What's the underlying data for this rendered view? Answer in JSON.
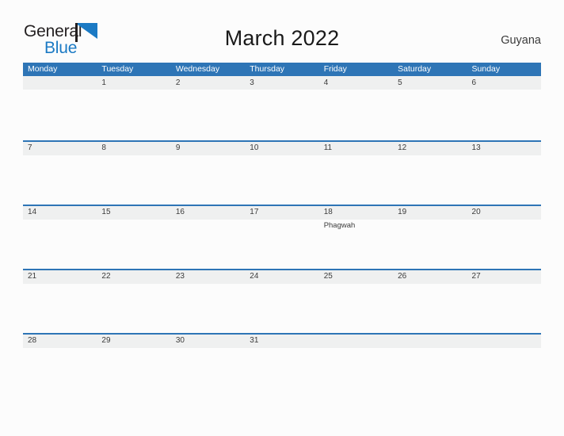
{
  "branding": {
    "logo_text_primary": "General",
    "logo_text_secondary": "Blue",
    "logo_icon": "blue-flag-triangle",
    "accent_color": "#2e75b6",
    "logo_blue": "#1b7ac4"
  },
  "header": {
    "title": "March 2022",
    "region": "Guyana"
  },
  "calendar": {
    "month": "March",
    "year": "2022",
    "weekday_headers": [
      "Monday",
      "Tuesday",
      "Wednesday",
      "Thursday",
      "Friday",
      "Saturday",
      "Sunday"
    ],
    "weeks": [
      {
        "bordered": false,
        "days": [
          {
            "date": "",
            "event": ""
          },
          {
            "date": "1",
            "event": ""
          },
          {
            "date": "2",
            "event": ""
          },
          {
            "date": "3",
            "event": ""
          },
          {
            "date": "4",
            "event": ""
          },
          {
            "date": "5",
            "event": ""
          },
          {
            "date": "6",
            "event": ""
          }
        ]
      },
      {
        "bordered": true,
        "days": [
          {
            "date": "7",
            "event": ""
          },
          {
            "date": "8",
            "event": ""
          },
          {
            "date": "9",
            "event": ""
          },
          {
            "date": "10",
            "event": ""
          },
          {
            "date": "11",
            "event": ""
          },
          {
            "date": "12",
            "event": ""
          },
          {
            "date": "13",
            "event": ""
          }
        ]
      },
      {
        "bordered": true,
        "days": [
          {
            "date": "14",
            "event": ""
          },
          {
            "date": "15",
            "event": ""
          },
          {
            "date": "16",
            "event": ""
          },
          {
            "date": "17",
            "event": ""
          },
          {
            "date": "18",
            "event": "Phagwah"
          },
          {
            "date": "19",
            "event": ""
          },
          {
            "date": "20",
            "event": ""
          }
        ]
      },
      {
        "bordered": true,
        "days": [
          {
            "date": "21",
            "event": ""
          },
          {
            "date": "22",
            "event": ""
          },
          {
            "date": "23",
            "event": ""
          },
          {
            "date": "24",
            "event": ""
          },
          {
            "date": "25",
            "event": ""
          },
          {
            "date": "26",
            "event": ""
          },
          {
            "date": "27",
            "event": ""
          }
        ]
      },
      {
        "bordered": true,
        "days": [
          {
            "date": "28",
            "event": ""
          },
          {
            "date": "29",
            "event": ""
          },
          {
            "date": "30",
            "event": ""
          },
          {
            "date": "31",
            "event": ""
          },
          {
            "date": "",
            "event": ""
          },
          {
            "date": "",
            "event": ""
          },
          {
            "date": "",
            "event": ""
          }
        ]
      }
    ]
  }
}
